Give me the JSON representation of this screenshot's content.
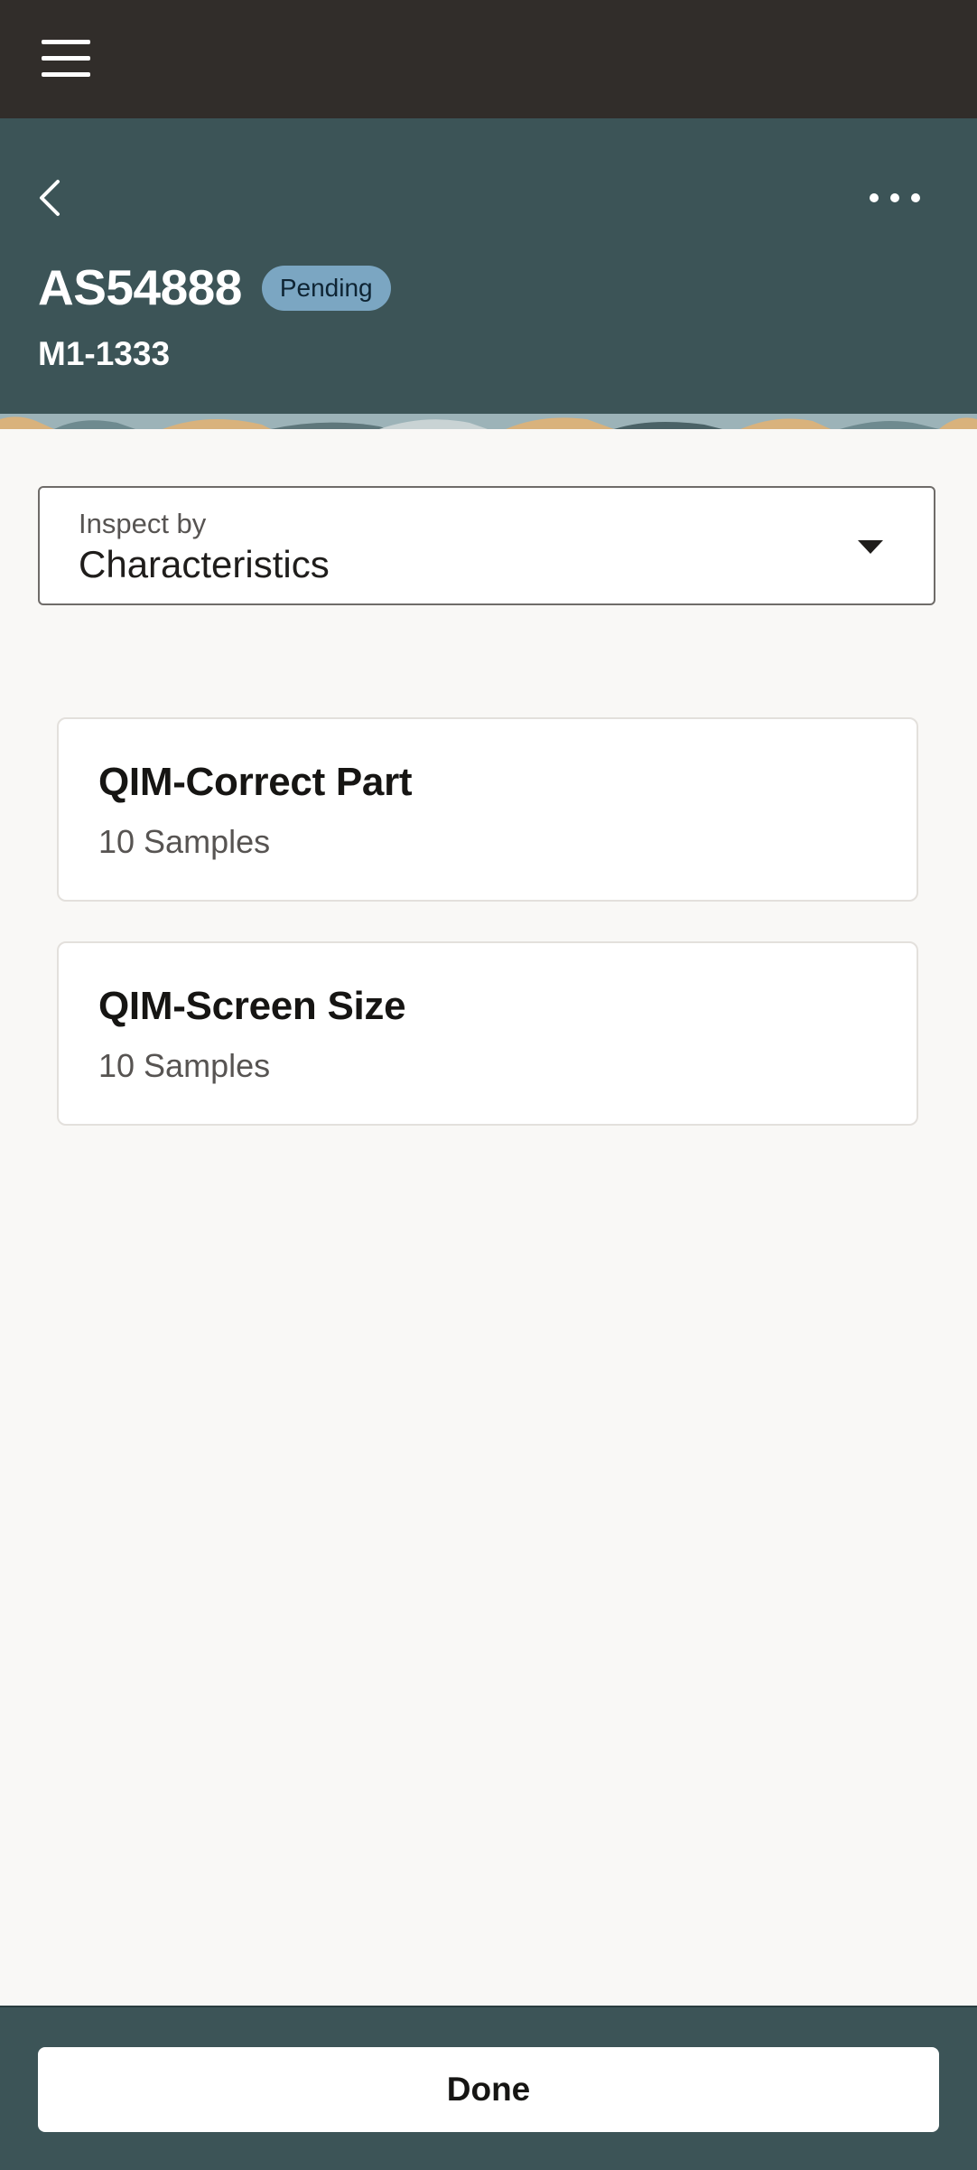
{
  "header": {
    "title": "AS54888",
    "status": "Pending",
    "subtitle": "M1-1333"
  },
  "inspect": {
    "label": "Inspect by",
    "value": "Characteristics"
  },
  "characteristics": [
    {
      "name": "QIM-Correct Part",
      "samples": "10 Samples"
    },
    {
      "name": "QIM-Screen Size",
      "samples": "10 Samples"
    }
  ],
  "footer": {
    "done_label": "Done"
  },
  "colors": {
    "top_bar": "#312d2a",
    "header": "#3c5457",
    "badge": "#7ba6c2",
    "page_background": "#f9f8f6"
  },
  "icons": [
    "hamburger-menu-icon",
    "back-chevron-icon",
    "more-options-icon",
    "caret-down-icon"
  ]
}
